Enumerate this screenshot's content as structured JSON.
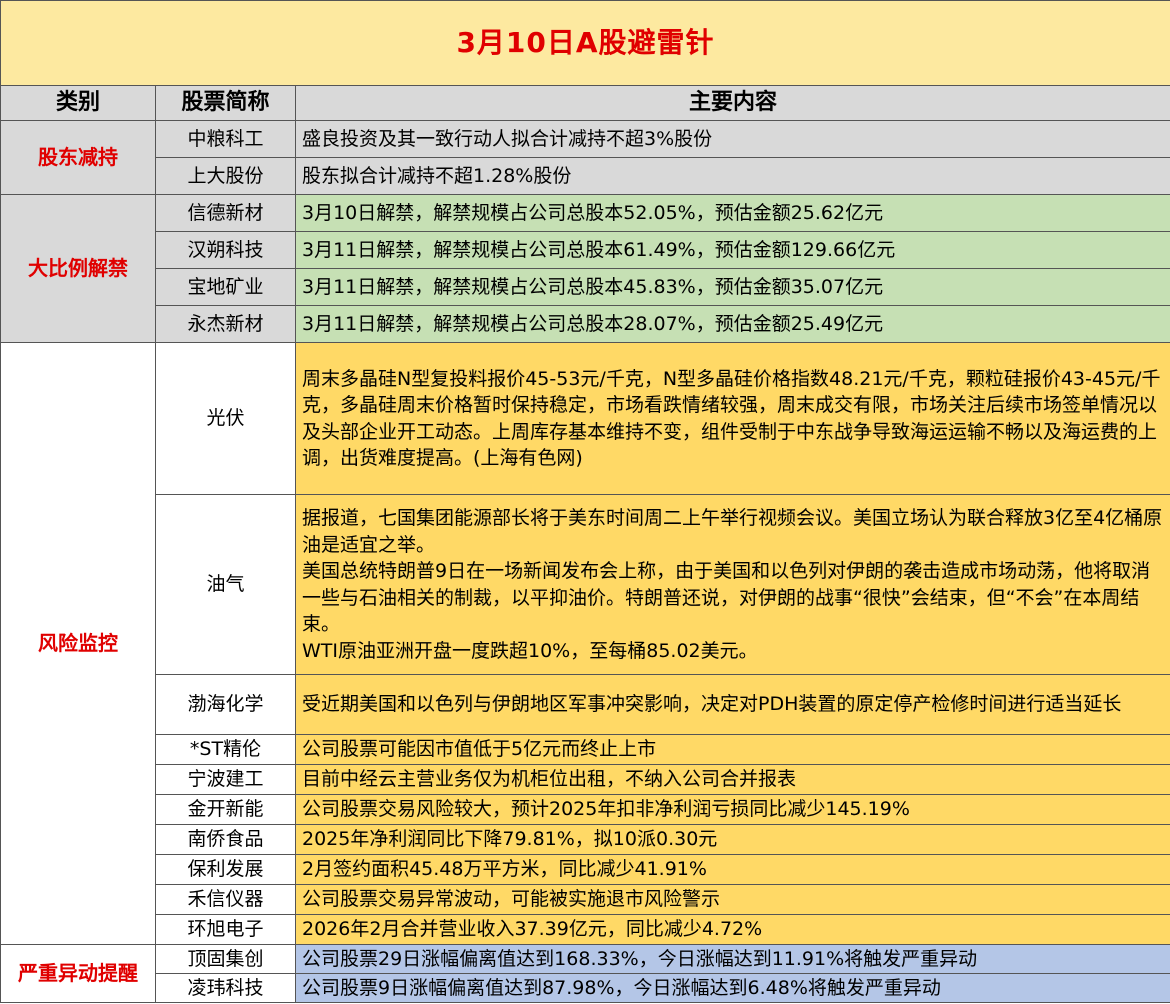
{
  "title": "3月10日A股避雷针",
  "headers": {
    "category": "类别",
    "stock": "股票简称",
    "content": "主要内容"
  },
  "groups": [
    {
      "category": "股东减持",
      "rows": [
        {
          "name": "中粮科工",
          "content": "盛良投资及其一致行动人拟合计减持不超3%股份"
        },
        {
          "name": "上大股份",
          "content": "股东拟合计减持不超1.28%股份"
        }
      ]
    },
    {
      "category": "大比例解禁",
      "rows": [
        {
          "name": "信德新材",
          "content": "3月10日解禁，解禁规模占公司总股本52.05%，预估金额25.62亿元"
        },
        {
          "name": "汉朔科技",
          "content": "3月11日解禁，解禁规模占公司总股本61.49%，预估金额129.66亿元"
        },
        {
          "name": "宝地矿业",
          "content": "3月11日解禁，解禁规模占公司总股本45.83%，预估金额35.07亿元"
        },
        {
          "name": "永杰新材",
          "content": "3月11日解禁，解禁规模占公司总股本28.07%，预估金额25.49亿元"
        }
      ]
    },
    {
      "category": "风险监控",
      "rows": [
        {
          "name": "光伏",
          "content": "周末多晶硅N型复投料报价45-53元/千克，N型多晶硅价格指数48.21元/千克，颗粒硅报价43-45元/千克，多晶硅周末价格暂时保持稳定，市场看跌情绪较强，周末成交有限，市场关注后续市场签单情况以及头部企业开工动态。上周库存基本维持不变，组件受制于中东战争导致海运运输不畅以及海运费的上调，出货难度提高。(上海有色网)"
        },
        {
          "name": "油气",
          "content": "据报道，七国集团能源部长将于美东时间周二上午举行视频会议。美国立场认为联合释放3亿至4亿桶原油是适宜之举。",
          "content2": "美国总统特朗普9日在一场新闻发布会上称，由于美国和以色列对伊朗的袭击造成市场动荡，他将取消一些与石油相关的制裁，以平抑油价。特朗普还说，对伊朗的战事“很快”会结束，但“不会”在本周结束。",
          "content3": "WTI原油亚洲开盘一度跌超10%，至每桶85.02美元。"
        },
        {
          "name": "渤海化学",
          "content": "受近期美国和以色列与伊朗地区军事冲突影响，决定对PDH装置的原定停产检修时间进行适当延长"
        },
        {
          "name": "*ST精伦",
          "content": "公司股票可能因市值低于5亿元而终止上市"
        },
        {
          "name": "宁波建工",
          "content": "目前中经云主营业务仅为机柜位出租，不纳入公司合并报表"
        },
        {
          "name": "金开新能",
          "content": "公司股票交易风险较大，预计2025年扣非净利润亏损同比减少145.19%"
        },
        {
          "name": "南侨食品",
          "content": "2025年净利润同比下降79.81%，拟10派0.30元"
        },
        {
          "name": "保利发展",
          "content": "2月签约面积45.48万平方米，同比减少41.91%"
        },
        {
          "name": "禾信仪器",
          "content": "公司股票交易异常波动，可能被实施退市风险警示"
        },
        {
          "name": "环旭电子",
          "content": "2026年2月合并营业收入37.39亿元，同比减少4.72%"
        }
      ]
    },
    {
      "category": "严重异动提醒",
      "rows": [
        {
          "name": "顶固集创",
          "content": "公司股票29日涨幅偏离值达到168.33%，今日涨幅达到11.91%将触发严重异动"
        },
        {
          "name": "凌玮科技",
          "content": "公司股票9日涨幅偏离值达到87.98%，今日涨幅达到6.48%将触发严重异动"
        }
      ]
    }
  ],
  "colors": {
    "title_bg": "#fde9a0",
    "title_text": "#e00000",
    "header_bg": "#d9d9d9",
    "green": "#c6e0b4",
    "yellow": "#ffd966",
    "blue": "#b4c6e7"
  }
}
